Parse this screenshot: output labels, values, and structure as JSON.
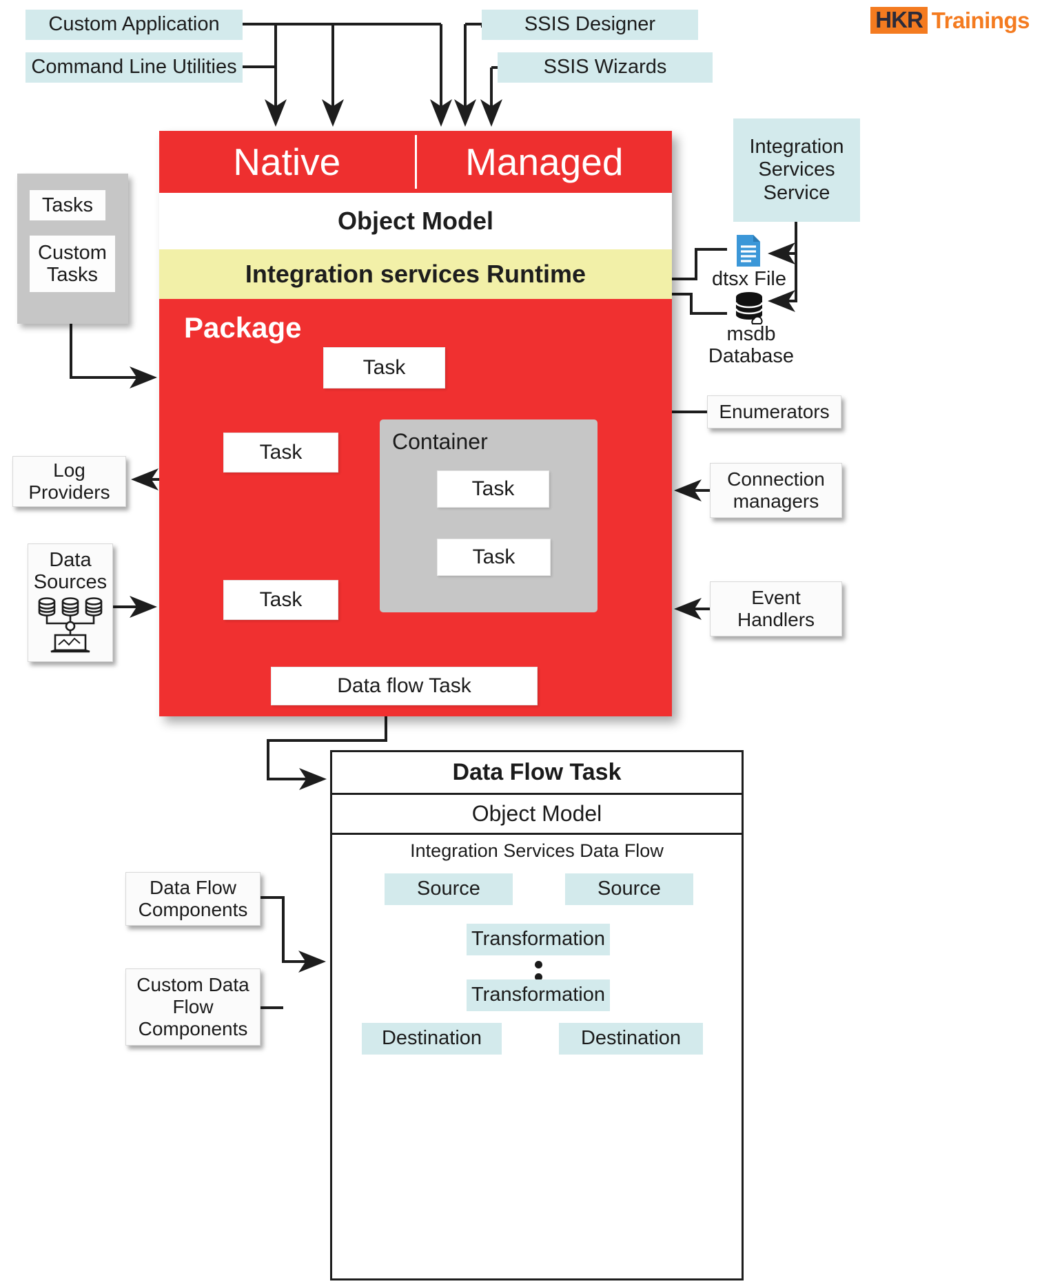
{
  "logo": {
    "mark": "HKR",
    "text": "Trainings"
  },
  "top_inputs": [
    {
      "label": "Custom Application"
    },
    {
      "label": "Command Line Utilities"
    },
    {
      "label": "SSIS Designer"
    },
    {
      "label": "SSIS Wizards"
    }
  ],
  "main_panel": {
    "bands": {
      "native": "Native",
      "managed": "Managed",
      "object_model": "Object Model",
      "runtime": "Integration services Runtime"
    },
    "package_label": "Package",
    "container_label": "Container",
    "tasks": {
      "top": "Task",
      "left_mid": "Task",
      "left_bottom": "Task",
      "container_top": "Task",
      "container_bottom": "Task",
      "data_flow": "Data flow Task"
    }
  },
  "left_labels": {
    "tasks_group": {
      "tasks": "Tasks",
      "custom_tasks": "Custom Tasks"
    },
    "log_providers": "Log Providers",
    "data_sources": "Data Sources"
  },
  "right_labels": {
    "integration_services_service": "Integration Services Service",
    "dtsx_file": "dtsx File",
    "msdb_database": "msdb Database",
    "enumerators": "Enumerators",
    "connection_managers": "Connection managers",
    "event_handlers": "Event Handlers"
  },
  "data_flow_panel": {
    "title": "Data Flow Task",
    "object_model": "Object Model",
    "subtitle": "Integration Services Data Flow",
    "nodes": {
      "source_left": "Source",
      "source_right": "Source",
      "transformation_top": "Transformation",
      "transformation_bottom": "Transformation",
      "destination_left": "Destination",
      "destination_right": "Destination"
    }
  },
  "bottom_left_labels": {
    "data_flow_components": "Data Flow Components",
    "custom_data_flow_components": "Custom Data Flow Components"
  },
  "colors": {
    "red": "#f03030",
    "yellow": "#f2f0a8",
    "teal": "#d3eaec",
    "gray": "#c6c6c6",
    "orange": "#f47b20",
    "line": "#1d1d1d"
  }
}
